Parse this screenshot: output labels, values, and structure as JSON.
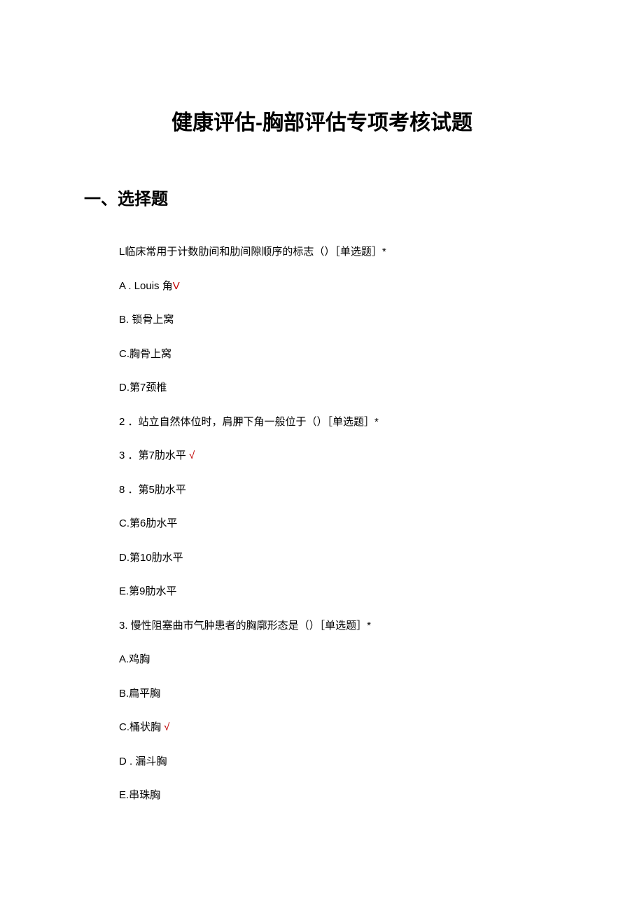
{
  "title": "健康评估-胸部评估专项考核试题",
  "section_heading": "一、选择题",
  "questions": [
    {
      "stem": "L临床常用于计数肋间和肋间隙顺序的标志（）［单选题］*",
      "options": [
        {
          "text": "A . Louis 角",
          "mark": "V"
        },
        {
          "text": "B. 锁骨上窝",
          "mark": ""
        },
        {
          "text": "C.胸骨上窝",
          "mark": ""
        },
        {
          "text": "D.第7颈椎",
          "mark": ""
        }
      ]
    },
    {
      "stem": "2 ．站立自然体位时，肩胛下角一般位于（）［单选题］*",
      "options": [
        {
          "text": "3 ．第7肋水平 ",
          "mark": "√"
        },
        {
          "text": "8 ．第5肋水平",
          "mark": ""
        },
        {
          "text": "C.第6肋水平",
          "mark": ""
        },
        {
          "text": "D.第10肋水平",
          "mark": ""
        },
        {
          "text": "E.第9肋水平",
          "mark": ""
        }
      ]
    },
    {
      "stem": "3. 慢性阻塞曲市气肿患者的胸廓形态是（）［单选题］*",
      "options": [
        {
          "text": "A.鸡胸",
          "mark": ""
        },
        {
          "text": "B.扁平胸",
          "mark": ""
        },
        {
          "text": "C.桶状胸 ",
          "mark": "√"
        },
        {
          "text": "D . 漏斗胸",
          "mark": ""
        },
        {
          "text": "E.串珠胸",
          "mark": ""
        }
      ]
    }
  ]
}
